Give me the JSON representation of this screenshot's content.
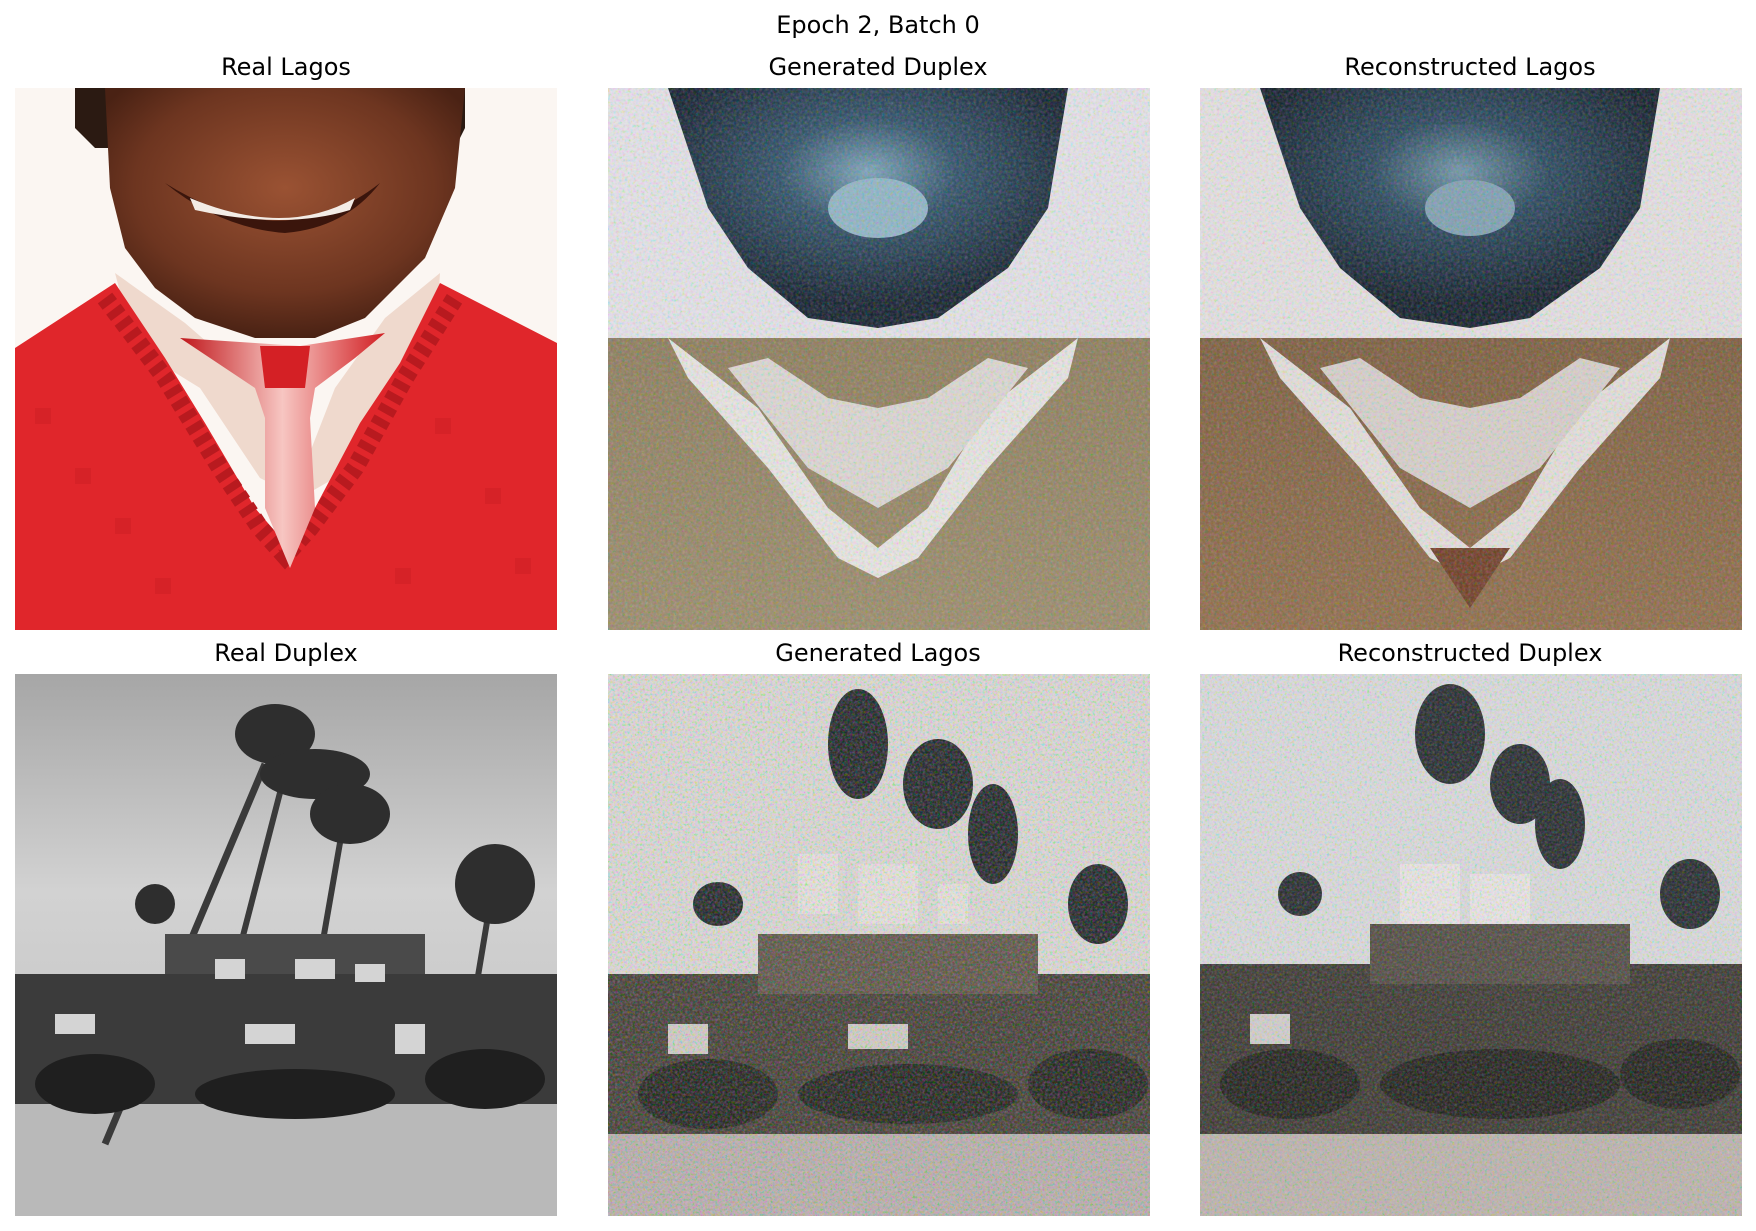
{
  "figure": {
    "title": "Epoch 2, Batch 0"
  },
  "panels": [
    {
      "title": "Real Lagos"
    },
    {
      "title": "Generated Duplex"
    },
    {
      "title": "Reconstructed Lagos"
    },
    {
      "title": "Real Duplex"
    },
    {
      "title": "Generated Lagos"
    },
    {
      "title": "Reconstructed Duplex"
    }
  ]
}
